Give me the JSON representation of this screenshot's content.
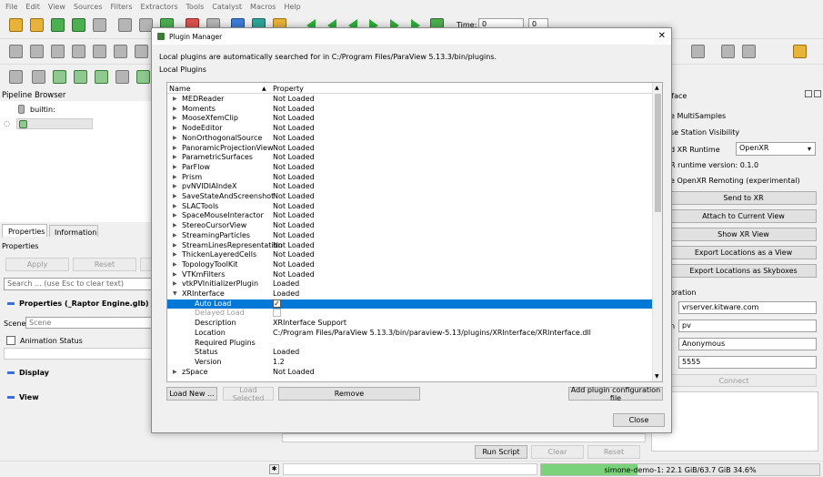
{
  "menubar": [
    "File",
    "Edit",
    "View",
    "Sources",
    "Filters",
    "Extractors",
    "Tools",
    "Catalyst",
    "Macros",
    "Help"
  ],
  "toolbar": {
    "time_label": "Time:",
    "time_value": "0",
    "time_index": "0"
  },
  "pipeline": {
    "title": "Pipeline Browser",
    "builtin": "builtin:"
  },
  "properties": {
    "tabs": [
      "Properties",
      "Information"
    ],
    "title": "Properties",
    "apply": "Apply",
    "reset": "Reset",
    "search_placeholder": "Search ... (use Esc to clear text)",
    "section_properties": "Properties (_Raptor Engine.glb)",
    "scene_label": "Scene",
    "scene_value": "Scene",
    "animation_status": "Animation Status",
    "display": "Display",
    "view": "View"
  },
  "xr": {
    "title": "rface",
    "multisamples": "e MultiSamples",
    "base_station": "se Station Visibility",
    "runtime_label": "d XR Runtime",
    "runtime_value": "OpenXR",
    "runtime_version": "R runtime version: 0.1.0",
    "remoting": "e OpenXR Remoting (experimental)",
    "buttons": [
      "Send to XR",
      "Attach to Current View",
      "Show XR View",
      "Export Locations as a View",
      "Export Locations as Skyboxes"
    ],
    "collab_label": "oration",
    "server": "vrserver.kitware.com",
    "n_label": "n",
    "session": "pv",
    "user": "Anonymous",
    "port": "5555",
    "connect": "Connect"
  },
  "python": {
    "run_script": "Run Script",
    "clear": "Clear",
    "reset": "Reset"
  },
  "statusbar": {
    "memory": "simone-demo-1: 22.1 GiB/63.7 GiB 34.6%",
    "memory_fraction": 0.346
  },
  "dialog": {
    "title": "Plugin Manager",
    "info": "Local plugins are automatically searched for in C:/Program Files/ParaView 5.13.3/bin/plugins.",
    "section": "Local Plugins",
    "col_name": "Name",
    "col_property": "Property",
    "rows": [
      {
        "name": "MEDReader",
        "prop": "Not Loaded"
      },
      {
        "name": "Moments",
        "prop": "Not Loaded"
      },
      {
        "name": "MooseXfemClip",
        "prop": "Not Loaded"
      },
      {
        "name": "NodeEditor",
        "prop": "Not Loaded"
      },
      {
        "name": "NonOrthogonalSource",
        "prop": "Not Loaded"
      },
      {
        "name": "PanoramicProjectionView",
        "prop": "Not Loaded"
      },
      {
        "name": "ParametricSurfaces",
        "prop": "Not Loaded"
      },
      {
        "name": "ParFlow",
        "prop": "Not Loaded"
      },
      {
        "name": "Prism",
        "prop": "Not Loaded"
      },
      {
        "name": "pvNVIDIAIndeX",
        "prop": "Not Loaded"
      },
      {
        "name": "SaveStateAndScreenshot",
        "prop": "Not Loaded"
      },
      {
        "name": "SLACTools",
        "prop": "Not Loaded"
      },
      {
        "name": "SpaceMouseInteractor",
        "prop": "Not Loaded"
      },
      {
        "name": "StereoCursorView",
        "prop": "Not Loaded"
      },
      {
        "name": "StreamingParticles",
        "prop": "Not Loaded"
      },
      {
        "name": "StreamLinesRepresentation",
        "prop": "Not Loaded"
      },
      {
        "name": "ThickenLayeredCells",
        "prop": "Not Loaded"
      },
      {
        "name": "TopologyToolKit",
        "prop": "Not Loaded"
      },
      {
        "name": "VTKmFilters",
        "prop": "Not Loaded"
      },
      {
        "name": "vtkPVInitializerPlugin",
        "prop": "Loaded"
      },
      {
        "name": "XRInterface",
        "prop": "Loaded"
      }
    ],
    "children": [
      {
        "name": "Auto Load",
        "prop": ""
      },
      {
        "name": "Delayed Load",
        "prop": ""
      },
      {
        "name": "Description",
        "prop": "XRInterface Support"
      },
      {
        "name": "Location",
        "prop": "C:/Program Files/ParaView 5.13.3/bin/paraview-5.13/plugins/XRInterface/XRInterface.dll"
      },
      {
        "name": "Required Plugins",
        "prop": ""
      },
      {
        "name": "Status",
        "prop": "Loaded"
      },
      {
        "name": "Version",
        "prop": "1.2"
      }
    ],
    "last_row": {
      "name": "zSpace",
      "prop": "Not Loaded"
    },
    "load_new": "Load New ...",
    "load_selected": "Load Selected",
    "remove": "Remove",
    "add_config": "Add plugin configuration file",
    "close": "Close"
  }
}
